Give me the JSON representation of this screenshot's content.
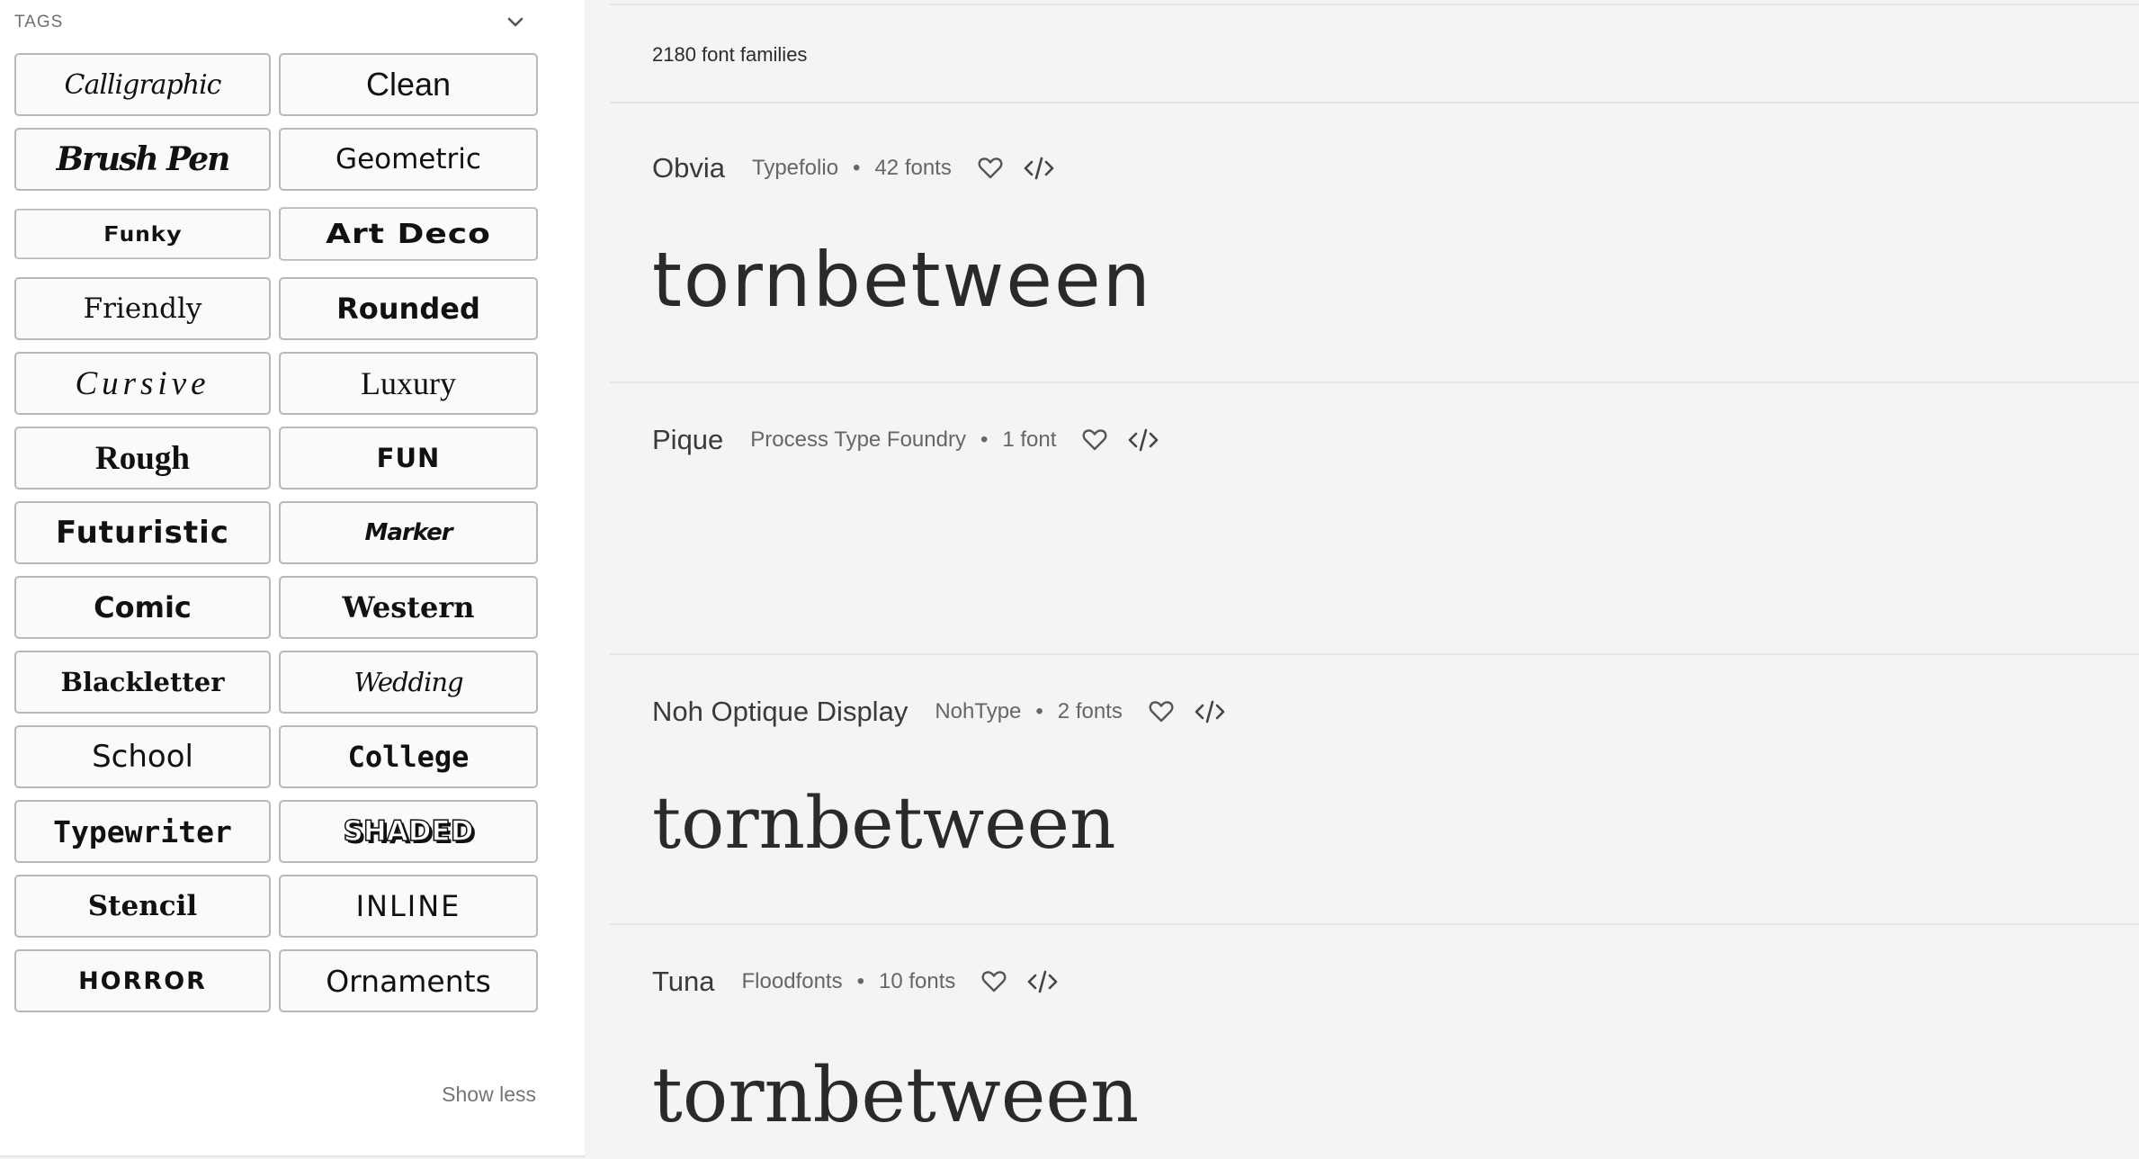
{
  "sidebar": {
    "tags_title": "TAGS",
    "tags": [
      "Calligraphic",
      "Clean",
      "Brush Pen",
      "Geometric",
      "Funky",
      "Art Deco",
      "Friendly",
      "Rounded",
      "Cursive",
      "Luxury",
      "Rough",
      "FUN",
      "Futuristic",
      "Marker",
      "Comic",
      "Western",
      "Blackletter",
      "Wedding",
      "School",
      "College",
      "Typewriter",
      "SHADED",
      "Stencil",
      "INLINE",
      "HORROR",
      "Ornaments"
    ],
    "show_less": "Show less"
  },
  "main": {
    "family_count": "2180 font families",
    "families": [
      {
        "name": "Obvia",
        "foundry": "Typefolio",
        "fonts": "42 fonts",
        "sample": "tornbetween"
      },
      {
        "name": "Pique",
        "foundry": "Process Type Foundry",
        "fonts": "1 font",
        "sample": ""
      },
      {
        "name": "Noh Optique Display",
        "foundry": "NohType",
        "fonts": "2 fonts",
        "sample": "tornbetween"
      },
      {
        "name": "Tuna",
        "foundry": "Floodfonts",
        "fonts": "10 fonts",
        "sample": "tornbetween"
      }
    ],
    "separator": "•"
  },
  "icons": {
    "collapse": "chevron-down-icon",
    "favorite": "heart-outline-icon",
    "embed": "code-brackets-icon"
  }
}
